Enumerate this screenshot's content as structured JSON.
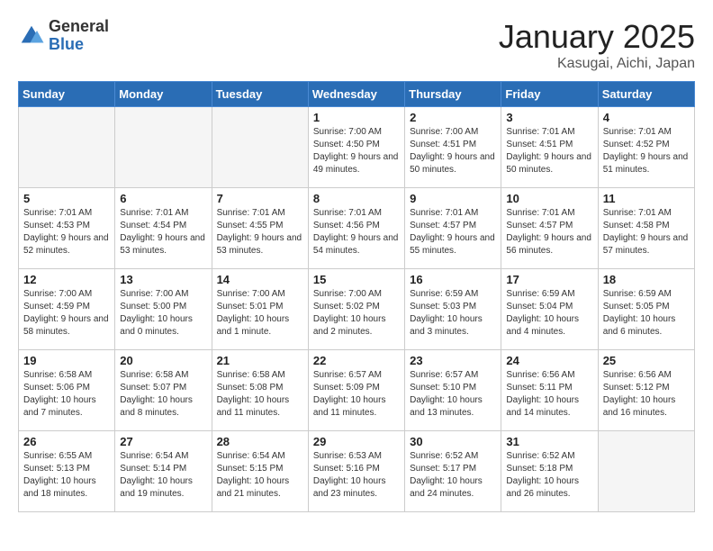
{
  "header": {
    "logo_general": "General",
    "logo_blue": "Blue",
    "month_title": "January 2025",
    "location": "Kasugai, Aichi, Japan"
  },
  "days_of_week": [
    "Sunday",
    "Monday",
    "Tuesday",
    "Wednesday",
    "Thursday",
    "Friday",
    "Saturday"
  ],
  "weeks": [
    [
      {
        "day": "",
        "empty": true
      },
      {
        "day": "",
        "empty": true
      },
      {
        "day": "",
        "empty": true
      },
      {
        "day": "1",
        "sunrise": "7:00 AM",
        "sunset": "4:50 PM",
        "daylight": "9 hours and 49 minutes."
      },
      {
        "day": "2",
        "sunrise": "7:00 AM",
        "sunset": "4:51 PM",
        "daylight": "9 hours and 50 minutes."
      },
      {
        "day": "3",
        "sunrise": "7:01 AM",
        "sunset": "4:51 PM",
        "daylight": "9 hours and 50 minutes."
      },
      {
        "day": "4",
        "sunrise": "7:01 AM",
        "sunset": "4:52 PM",
        "daylight": "9 hours and 51 minutes."
      }
    ],
    [
      {
        "day": "5",
        "sunrise": "7:01 AM",
        "sunset": "4:53 PM",
        "daylight": "9 hours and 52 minutes."
      },
      {
        "day": "6",
        "sunrise": "7:01 AM",
        "sunset": "4:54 PM",
        "daylight": "9 hours and 53 minutes."
      },
      {
        "day": "7",
        "sunrise": "7:01 AM",
        "sunset": "4:55 PM",
        "daylight": "9 hours and 53 minutes."
      },
      {
        "day": "8",
        "sunrise": "7:01 AM",
        "sunset": "4:56 PM",
        "daylight": "9 hours and 54 minutes."
      },
      {
        "day": "9",
        "sunrise": "7:01 AM",
        "sunset": "4:57 PM",
        "daylight": "9 hours and 55 minutes."
      },
      {
        "day": "10",
        "sunrise": "7:01 AM",
        "sunset": "4:57 PM",
        "daylight": "9 hours and 56 minutes."
      },
      {
        "day": "11",
        "sunrise": "7:01 AM",
        "sunset": "4:58 PM",
        "daylight": "9 hours and 57 minutes."
      }
    ],
    [
      {
        "day": "12",
        "sunrise": "7:00 AM",
        "sunset": "4:59 PM",
        "daylight": "9 hours and 58 minutes."
      },
      {
        "day": "13",
        "sunrise": "7:00 AM",
        "sunset": "5:00 PM",
        "daylight": "10 hours and 0 minutes."
      },
      {
        "day": "14",
        "sunrise": "7:00 AM",
        "sunset": "5:01 PM",
        "daylight": "10 hours and 1 minute."
      },
      {
        "day": "15",
        "sunrise": "7:00 AM",
        "sunset": "5:02 PM",
        "daylight": "10 hours and 2 minutes."
      },
      {
        "day": "16",
        "sunrise": "6:59 AM",
        "sunset": "5:03 PM",
        "daylight": "10 hours and 3 minutes."
      },
      {
        "day": "17",
        "sunrise": "6:59 AM",
        "sunset": "5:04 PM",
        "daylight": "10 hours and 4 minutes."
      },
      {
        "day": "18",
        "sunrise": "6:59 AM",
        "sunset": "5:05 PM",
        "daylight": "10 hours and 6 minutes."
      }
    ],
    [
      {
        "day": "19",
        "sunrise": "6:58 AM",
        "sunset": "5:06 PM",
        "daylight": "10 hours and 7 minutes."
      },
      {
        "day": "20",
        "sunrise": "6:58 AM",
        "sunset": "5:07 PM",
        "daylight": "10 hours and 8 minutes."
      },
      {
        "day": "21",
        "sunrise": "6:58 AM",
        "sunset": "5:08 PM",
        "daylight": "10 hours and 11 minutes."
      },
      {
        "day": "22",
        "sunrise": "6:57 AM",
        "sunset": "5:09 PM",
        "daylight": "10 hours and 11 minutes."
      },
      {
        "day": "23",
        "sunrise": "6:57 AM",
        "sunset": "5:10 PM",
        "daylight": "10 hours and 13 minutes."
      },
      {
        "day": "24",
        "sunrise": "6:56 AM",
        "sunset": "5:11 PM",
        "daylight": "10 hours and 14 minutes."
      },
      {
        "day": "25",
        "sunrise": "6:56 AM",
        "sunset": "5:12 PM",
        "daylight": "10 hours and 16 minutes."
      }
    ],
    [
      {
        "day": "26",
        "sunrise": "6:55 AM",
        "sunset": "5:13 PM",
        "daylight": "10 hours and 18 minutes."
      },
      {
        "day": "27",
        "sunrise": "6:54 AM",
        "sunset": "5:14 PM",
        "daylight": "10 hours and 19 minutes."
      },
      {
        "day": "28",
        "sunrise": "6:54 AM",
        "sunset": "5:15 PM",
        "daylight": "10 hours and 21 minutes."
      },
      {
        "day": "29",
        "sunrise": "6:53 AM",
        "sunset": "5:16 PM",
        "daylight": "10 hours and 23 minutes."
      },
      {
        "day": "30",
        "sunrise": "6:52 AM",
        "sunset": "5:17 PM",
        "daylight": "10 hours and 24 minutes."
      },
      {
        "day": "31",
        "sunrise": "6:52 AM",
        "sunset": "5:18 PM",
        "daylight": "10 hours and 26 minutes."
      },
      {
        "day": "",
        "empty": true
      }
    ]
  ]
}
